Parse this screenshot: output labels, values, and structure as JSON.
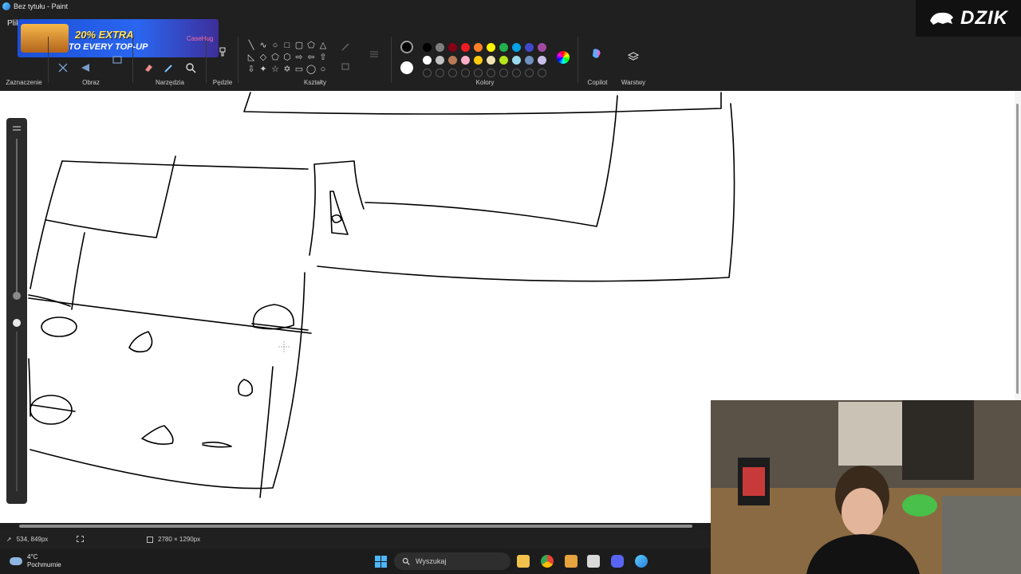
{
  "window": {
    "title": "Bez tytułu - Paint"
  },
  "menu": {
    "file": "Plik"
  },
  "ad": {
    "headline": "20% EXTRA",
    "subline": "TO EVERY TOP-UP",
    "brand": "CaseHug"
  },
  "ribbon": {
    "groups": {
      "selection": "Zaznaczenie",
      "image": "Obraz",
      "tools": "Narzędzia",
      "brushes": "Pędzle",
      "shapes": "Kształty",
      "colors": "Kolory",
      "copilot": "Copilot",
      "layers": "Warstwy"
    },
    "palette_row1": [
      "#000000",
      "#7f7f7f",
      "#880015",
      "#ed1c24",
      "#ff7f27",
      "#fff200",
      "#22b14c",
      "#00a2e8",
      "#3f48cc",
      "#a349a4"
    ],
    "palette_row2": [
      "#ffffff",
      "#c3c3c3",
      "#b97a57",
      "#ffaec9",
      "#ffc90e",
      "#efe4b0",
      "#b5e61d",
      "#99d9ea",
      "#7092be",
      "#c8bfe7"
    ],
    "primary_color": "#000000",
    "secondary_color": "#ffffff"
  },
  "overlay": {
    "logo_text": "DZIK"
  },
  "status": {
    "cursor_position": "534, 849px",
    "canvas_size": "2780 × 1290px"
  },
  "taskbar": {
    "weather_temp": "4°C",
    "weather_desc": "Pochmurnie",
    "search_placeholder": "Wyszukaj"
  }
}
